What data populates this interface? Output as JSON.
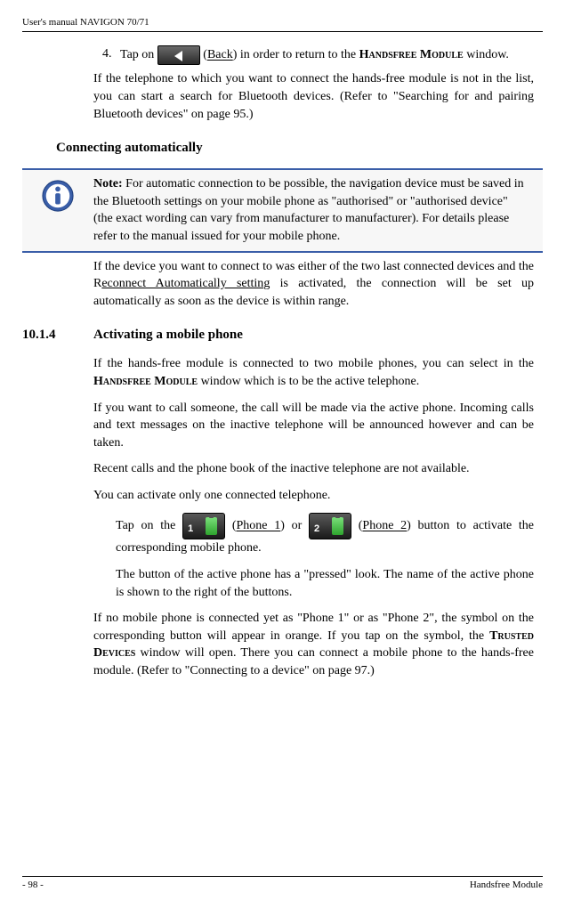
{
  "header": {
    "title": "User's manual NAVIGON 70/71"
  },
  "step4": {
    "num": "4.",
    "pre": "Tap on ",
    "back": "Back",
    "post1": ") in order to return to the ",
    "hfm": "Handsfree Module",
    "post2": " window."
  },
  "para1": "If the telephone to which you want to connect the hands-free module is not in the list, you can start a search for Bluetooth devices. (Refer to \"Searching for and pairing Bluetooth devices\" on page 95.)",
  "heading1": "Connecting automatically",
  "note": {
    "label": "Note:",
    "text": " For automatic connection to be possible, the navigation device must be saved in the Bluetooth settings on your mobile phone as \"authorised\" or \"authorised device\" (the exact wording can vary from manufacturer to manufacturer). For details please refer to the manual issued for your mobile phone."
  },
  "para2a": "If the device you want to connect to was either of the two last connected devices and the R",
  "para2link": "econnect Automatically settin",
  "para2b": "g is activated, the connection will be set up automatically as soon as the device is within range.",
  "section": {
    "num": "10.1.4",
    "title": "Activating a mobile phone"
  },
  "para3a": "If the hands-free module is connected to two mobile phones, you can select in the ",
  "para3hfm": "Handsfree Module",
  "para3b": " window which is to be the active telephone.",
  "para4": "If you want to call someone, the call will be made via the active phone. Incoming calls and text messages on the inactive telephone will be announced however and can be taken.",
  "para5": "Recent calls and the phone book of the inactive telephone are not available.",
  "para6": "You can activate only one connected telephone.",
  "phoneline": {
    "pre": "Tap on the ",
    "p1": "Phone 1",
    "mid": ") or ",
    "p2": "Phone 2",
    "post": ") button to activate the corresponding mobile phone."
  },
  "para7": "The button of the active phone has a \"pressed\" look. The name of the active phone is shown to the right of the buttons.",
  "para8a": "If no mobile phone is connected yet as \"Phone 1\" or as \"Phone 2\", the symbol on the corresponding button will appear in orange. If you tap on the symbol, the ",
  "para8td": "Trusted Devices",
  "para8b": " window will open. There you can connect a mobile phone to the hands-free module. (Refer to \"Connecting to a device\" on page 97.)",
  "footer": {
    "left": "- 98 -",
    "right": "Handsfree Module"
  },
  "btnnum": {
    "one": "1",
    "two": "2"
  }
}
